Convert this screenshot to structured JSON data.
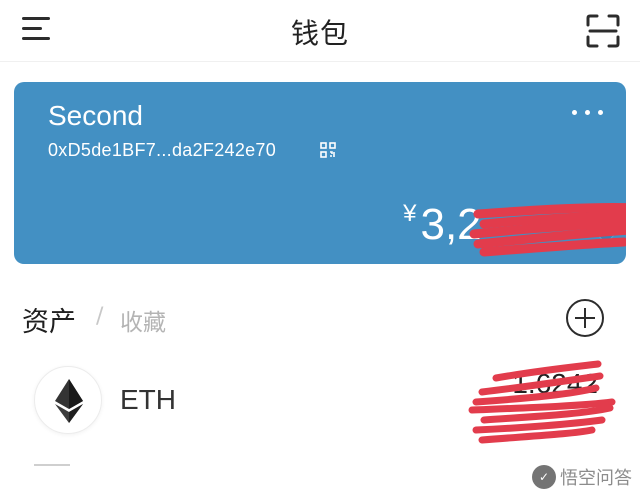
{
  "header": {
    "title": "钱包",
    "menu_icon": "hamburger-icon",
    "scan_icon": "scan-icon"
  },
  "wallet_card": {
    "name": "Second",
    "address": "0xD5de1BF7...da2F242e70",
    "currency_symbol": "¥",
    "balance_visible": "3,2",
    "background_color": "#4390c3"
  },
  "assets": {
    "tab_assets": "资产",
    "tab_separator": "/",
    "tab_collectibles": "收藏",
    "add_icon": "plus-circle-icon"
  },
  "tokens": [
    {
      "symbol": "ETH",
      "amount_visible": "1.6242",
      "icon": "ethereum-icon"
    }
  ],
  "watermark": {
    "text": "悟空问答"
  },
  "colors": {
    "redaction": "#e23c4c",
    "card": "#4390c3"
  }
}
